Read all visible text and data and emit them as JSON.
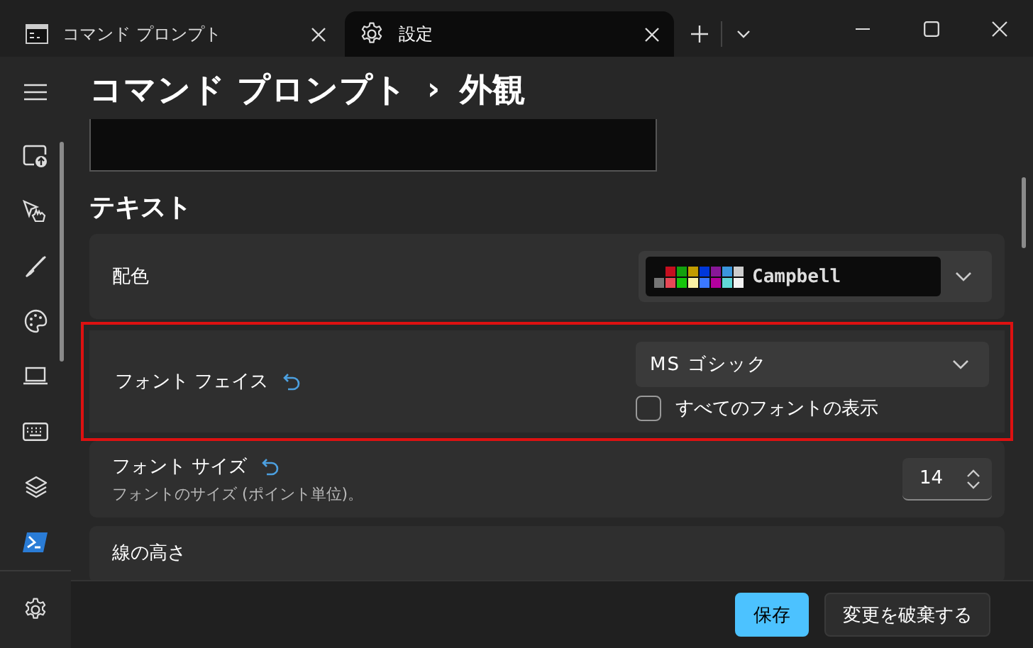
{
  "tabs": [
    {
      "label": "コマンド プロンプト",
      "kind": "terminal",
      "selected": false
    },
    {
      "label": "設定",
      "kind": "settings",
      "selected": true
    }
  ],
  "breadcrumb": {
    "items": [
      "コマンド プロンプト",
      "外観"
    ],
    "separator": "›"
  },
  "section_title": "テキスト",
  "settings": [
    {
      "kind": "scheme",
      "label": "配色",
      "value": "Campbell",
      "highlighted": false,
      "reset": false
    },
    {
      "kind": "font",
      "label": "フォント フェイス",
      "value": "MS ゴシック",
      "checkbox": {
        "label": "すべてのフォントの表示",
        "checked": false
      },
      "highlighted": true,
      "reset": true
    },
    {
      "kind": "number",
      "label": "フォント サイズ",
      "description": "フォントのサイズ (ポイント単位)。",
      "value": "14",
      "highlighted": false,
      "reset": true
    },
    {
      "kind": "heading",
      "label": "線の高さ",
      "highlighted": false,
      "reset": false
    }
  ],
  "footer": {
    "buttons": [
      {
        "label": "保存",
        "primary": true
      },
      {
        "label": "変更を破棄する",
        "primary": false
      }
    ]
  }
}
